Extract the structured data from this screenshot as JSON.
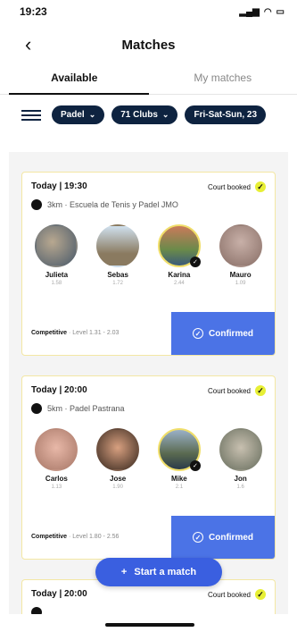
{
  "status": {
    "time": "19:23",
    "signal": "signal-icon",
    "wifi": "wifi-icon",
    "battery": "battery-icon"
  },
  "header": {
    "title": "Matches",
    "back_icon": "chevron-left-icon"
  },
  "tabs": [
    {
      "label": "Available",
      "active": true
    },
    {
      "label": "My matches",
      "active": false
    }
  ],
  "filters": {
    "chips": [
      "Padel",
      "71 Clubs",
      "Fri-Sat-Sun, 23"
    ]
  },
  "matches": [
    {
      "time": "Today | 19:30",
      "court_status": "Court booked",
      "venue": "3km · Escuela de Tenis y Padel JMO",
      "players": [
        {
          "name": "Julieta",
          "level": "1.58"
        },
        {
          "name": "Sebas",
          "level": "1.72"
        },
        {
          "name": "Karina",
          "level": "2.44"
        },
        {
          "name": "Mauro",
          "level": "1.09"
        }
      ],
      "level_label": "Competitive",
      "level_range": "· Level 1.31 - 2.03",
      "confirm_label": "Confirmed"
    },
    {
      "time": "Today | 20:00",
      "court_status": "Court booked",
      "venue": "5km · Padel Pastrana",
      "players": [
        {
          "name": "Carlos",
          "level": "1.13"
        },
        {
          "name": "Jose",
          "level": "1.90"
        },
        {
          "name": "Mike",
          "level": "2.1"
        },
        {
          "name": "Jon",
          "level": "1.6"
        }
      ],
      "level_label": "Competitive",
      "level_range": "· Level 1.80 - 2.56",
      "confirm_label": "Confirmed"
    },
    {
      "time": "Today | 20:00",
      "court_status": "Court booked"
    }
  ],
  "fab": {
    "label": "Start a match"
  }
}
